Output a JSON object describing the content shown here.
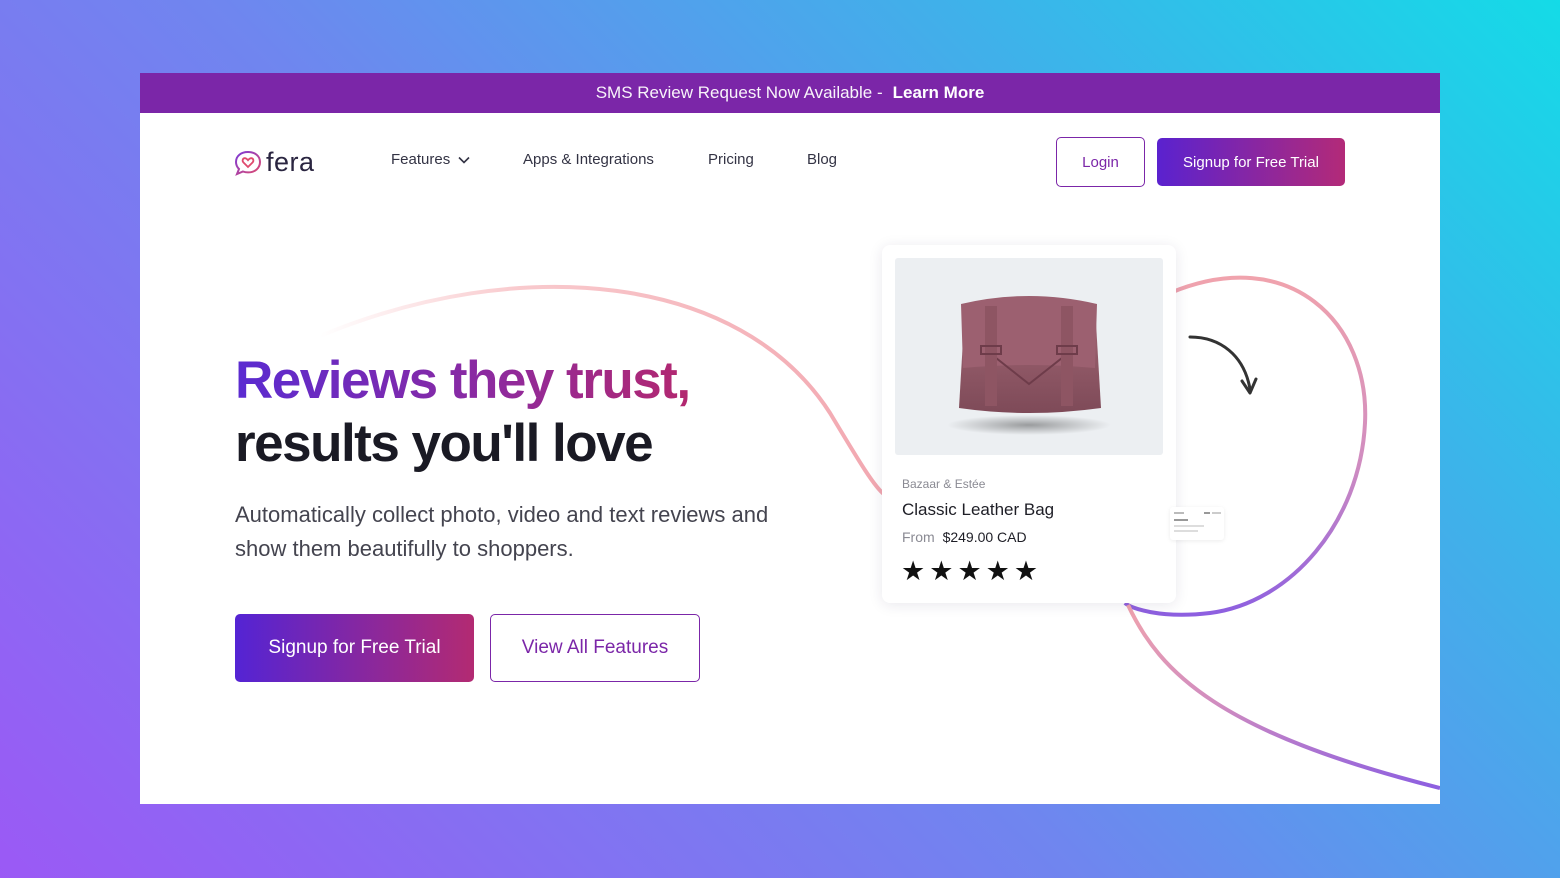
{
  "announcement": {
    "text": "SMS Review Request Now Available -",
    "link": "Learn More"
  },
  "nav": {
    "logo_text": "fera",
    "items": [
      {
        "label": "Features"
      },
      {
        "label": "Apps & Integrations"
      },
      {
        "label": "Pricing"
      },
      {
        "label": "Blog"
      }
    ],
    "login": "Login",
    "signup": "Signup for Free Trial"
  },
  "hero": {
    "headline_1": "Reviews they trust,",
    "headline_2": "results you'll love",
    "subtext": "Automatically collect photo, video and text reviews and show them beautifully to shoppers.",
    "primary_cta": "Signup for Free Trial",
    "secondary_cta": "View All Features"
  },
  "product_card": {
    "brand": "Bazaar & Estée",
    "name": "Classic Leather Bag",
    "price_prefix": "From",
    "price": "$249.00 CAD",
    "stars": [
      "★",
      "★",
      "★",
      "★",
      "★"
    ]
  },
  "colors": {
    "brand_purple": "#7b26a8",
    "gradient_start": "#5424d4",
    "gradient_end": "#b32a72"
  }
}
